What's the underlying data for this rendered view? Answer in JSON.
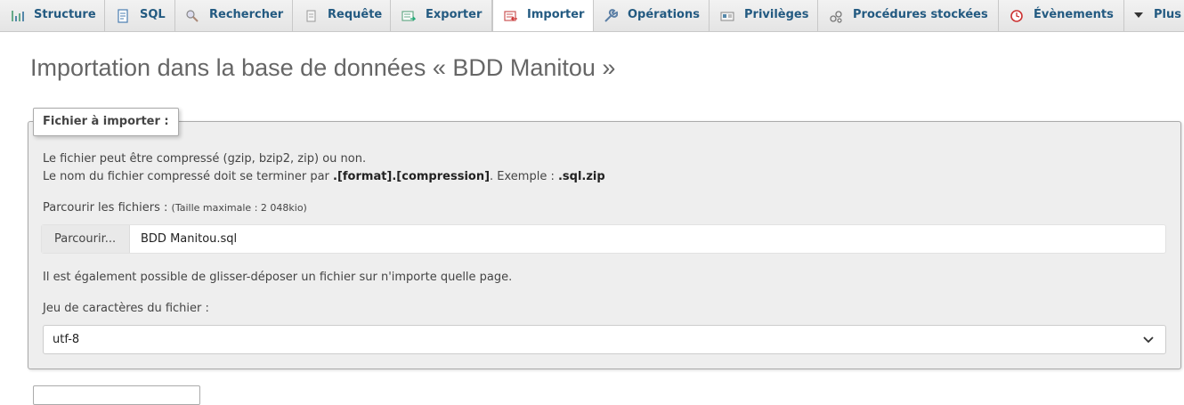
{
  "tabs": [
    {
      "label": "Structure",
      "icon": "structure-icon"
    },
    {
      "label": "SQL",
      "icon": "sql-icon"
    },
    {
      "label": "Rechercher",
      "icon": "search-icon"
    },
    {
      "label": "Requête",
      "icon": "query-icon"
    },
    {
      "label": "Exporter",
      "icon": "export-icon"
    },
    {
      "label": "Importer",
      "icon": "import-icon",
      "active": true
    },
    {
      "label": "Opérations",
      "icon": "wrench-icon"
    },
    {
      "label": "Privilèges",
      "icon": "privileges-icon"
    },
    {
      "label": "Procédures stockées",
      "icon": "routines-icon"
    },
    {
      "label": "Évènements",
      "icon": "events-icon"
    },
    {
      "label": "Plus",
      "icon": "caret-down-icon"
    }
  ],
  "page_title": "Importation dans la base de données « BDD Manitou »",
  "file_section": {
    "legend": "Fichier à importer :",
    "line1": "Le fichier peut être compressé (gzip, bzip2, zip) ou non.",
    "line2_prefix": "Le nom du fichier compressé doit se terminer par ",
    "line2_format": ".[format].[compression]",
    "line2_middle": ". Exemple : ",
    "line2_example": ".sql.zip",
    "browse_label": "Parcourir les fichiers : ",
    "max_size": "(Taille maximale : 2 048kio)",
    "browse_button": "Parcourir...",
    "file_name": "BDD Manitou.sql",
    "drag_hint": "Il est également possible de glisser-déposer un fichier sur n'importe quelle page.",
    "charset_label": "Jeu de caractères du fichier :",
    "charset_value": "utf-8"
  },
  "colors": {
    "tab_text": "#235a81",
    "title": "#666666",
    "fieldset_bg": "#eeeeee"
  }
}
